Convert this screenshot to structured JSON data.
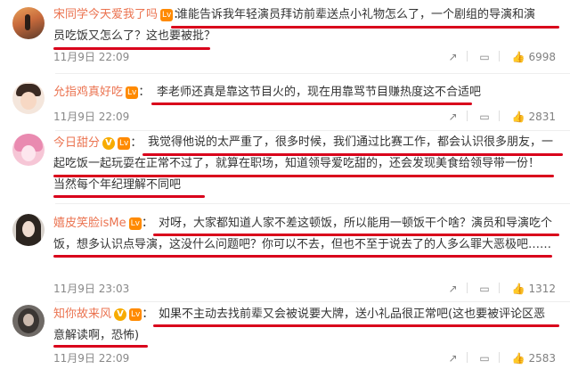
{
  "comments": [
    {
      "user": "宋同学今天爱我了吗",
      "badge": "",
      "lines": [
        "谁能告诉我年轻演员拜访前辈送点小礼物怎么了，一个剧组的导演和演",
        "员吃饭又怎么了？这也要被批？"
      ],
      "date": "11月9日 22:09",
      "reply_icon": "↗",
      "comment_icon": "▭",
      "like_icon": "👍",
      "likes": "6998"
    },
    {
      "user": "允指鸡真好吃",
      "badge": "",
      "lines": [
        "李老师还真是靠这节目火的，现在用靠骂节目赚热度这不合适吧"
      ],
      "date": "11月9日 22:09",
      "reply_icon": "↗",
      "comment_icon": "▭",
      "like_icon": "👍",
      "likes": "2831"
    },
    {
      "user": "今日甜分",
      "badge": "V",
      "lines": [
        "我觉得他说的太严重了，很多时候，我们通过比赛工作，都会认识很多朋友，一",
        "起吃饭一起玩耍在正常不过了，就算在职场，知道领导爱吃甜的，还会发现美食给领导带一份！",
        "当然每个年纪理解不同吧"
      ],
      "date": "",
      "reply_icon": "",
      "comment_icon": "",
      "like_icon": "",
      "likes": ""
    },
    {
      "user": "嬉皮笑脸isMe",
      "badge": "",
      "lines": [
        "对呀，大家都知道人家不差这顿饭，所以能用一顿饭干个啥？演员和导演吃个",
        "饭，想多认识点导演，这没什么问题吧？你可以不去，但也不至于说去了的人多么罪大恶极吧……"
      ],
      "date": "11月9日 23:03",
      "reply_icon": "↗",
      "comment_icon": "▭",
      "like_icon": "👍",
      "likes": "1312"
    },
    {
      "user": "知你故来风",
      "badge": "V",
      "lines": [
        "如果不主动去找前辈又会被说要大牌，送小礼品很正常吧(这也要被评论区恶",
        "意解读啊，恐怖)"
      ],
      "date": "11月9日 22:09",
      "reply_icon": "↗",
      "comment_icon": "▭",
      "like_icon": "👍",
      "likes": "2583"
    }
  ],
  "colors": {
    "name": "#eb7350",
    "underline": "#d9001b",
    "text": "#333333",
    "meta": "#888888"
  }
}
